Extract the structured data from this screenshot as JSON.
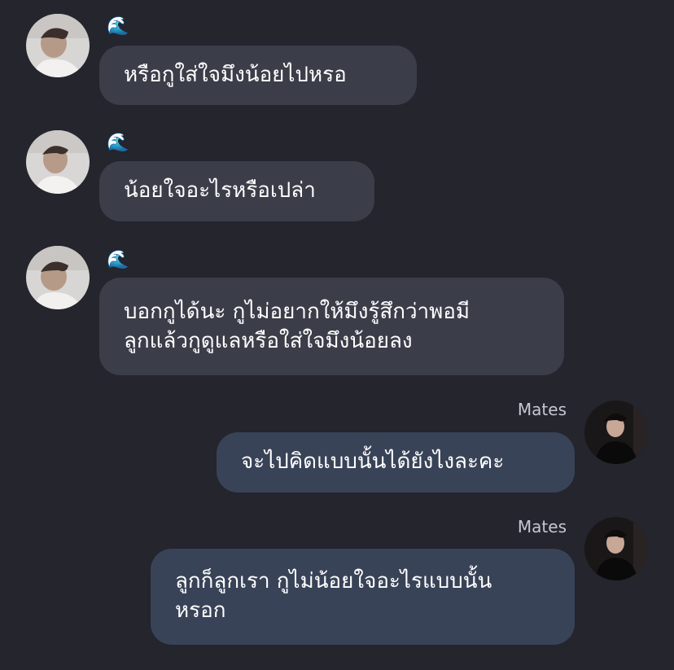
{
  "theme": {
    "background": "#24252d",
    "incoming_bubble": "#3b3e49",
    "outgoing_bubble": "#394357",
    "text": "#ffffff",
    "sender_name": "#c4c8d2"
  },
  "messages": [
    {
      "direction": "incoming",
      "sender": "🌊",
      "avatar": "contact-avatar-photo",
      "text": "หรือกูใส่ใจมึงน้อยไปหรอ"
    },
    {
      "direction": "incoming",
      "sender": "🌊",
      "avatar": "contact-avatar-photo",
      "text": "น้อยใจอะไรหรือเปล่า"
    },
    {
      "direction": "incoming",
      "sender": "🌊",
      "avatar": "contact-avatar-photo",
      "text": "บอกกูได้นะ กูไม่อยากให้มึงรู้สึกว่าพอมี\nลูกแล้วกูดูแลหรือใส่ใจมึงน้อยลง"
    },
    {
      "direction": "outgoing",
      "sender": "Mates",
      "avatar": "mates-avatar-photo",
      "text": "จะไปคิดแบบนั้นได้ยังไงละคะ"
    },
    {
      "direction": "outgoing",
      "sender": "Mates",
      "avatar": "mates-avatar-photo",
      "text": "ลูกก็ลูกเรา กูไม่น้อยใจอะไรแบบนั้น\nหรอก"
    }
  ]
}
